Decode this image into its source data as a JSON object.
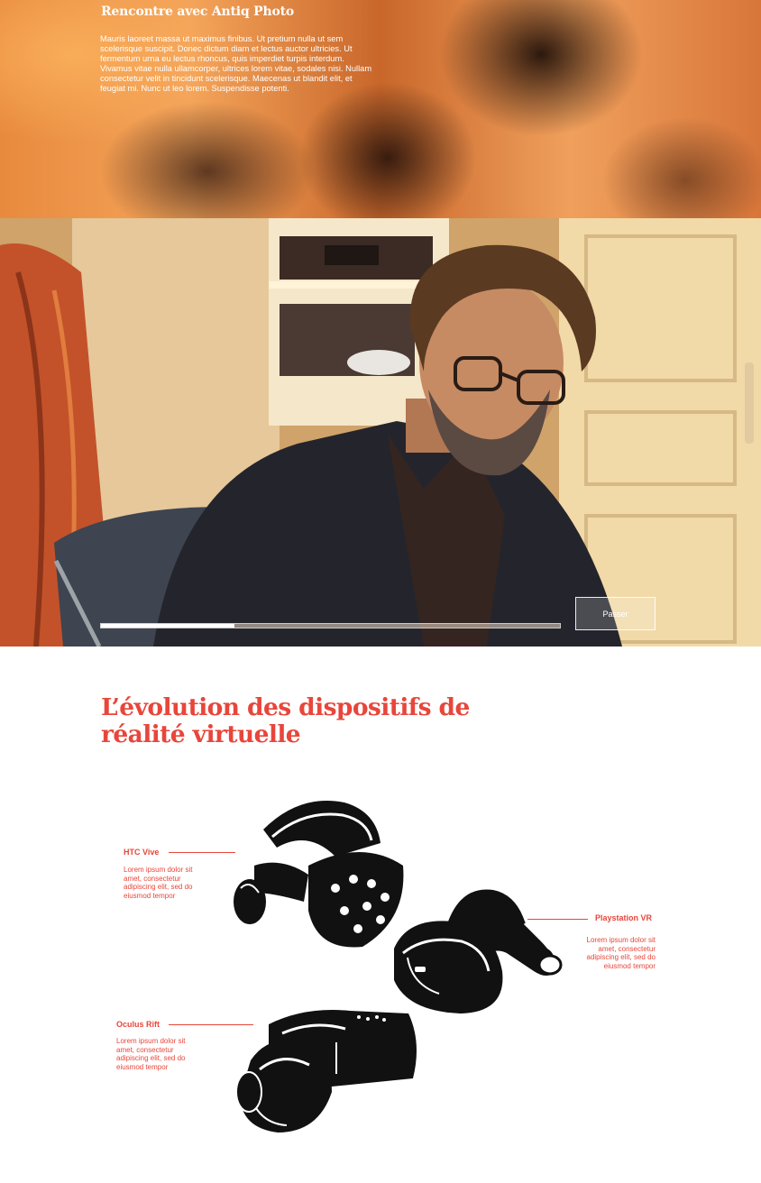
{
  "hero": {
    "title": "Rencontre avec Antiq Photo",
    "text": "Mauris laoreet massa ut maximus finibus. Ut pretium nulla ut sem scelerisque suscipit. Donec dictum diam et lectus auctor ultricies. Ut fermentum urna eu lectus rhoncus, quis imperdiet turpis interdum. Vivamus vitae nulla ullamcorper, ultrices lorem vitae, sodales nisi. Nullam consectetur velit in tincidunt scelerisque. Maecenas ut blandit elit, et feugiat mi. Nunc ut leo lorem. Suspendisse potenti."
  },
  "video": {
    "skip_label": "Passer",
    "progress": 0.29
  },
  "section": {
    "title": "L’évolution des dispositifs de réalité virtuelle"
  },
  "devices": [
    {
      "name": "HTC Vive",
      "description": "Lorem ipsum dolor sit amet, consectetur adipiscing elit, sed do eiusmod tempor"
    },
    {
      "name": "Playstation VR",
      "description": "Lorem ipsum dolor sit amet, consectetur adipiscing elit, sed do eiusmod tempor"
    },
    {
      "name": "Oculus Rift",
      "description": "Lorem ipsum dolor sit amet, consectetur adipiscing elit, sed do eiusmod tempor"
    }
  ],
  "colors": {
    "accent": "#e8463b",
    "text_on_dark": "#ffffff"
  }
}
